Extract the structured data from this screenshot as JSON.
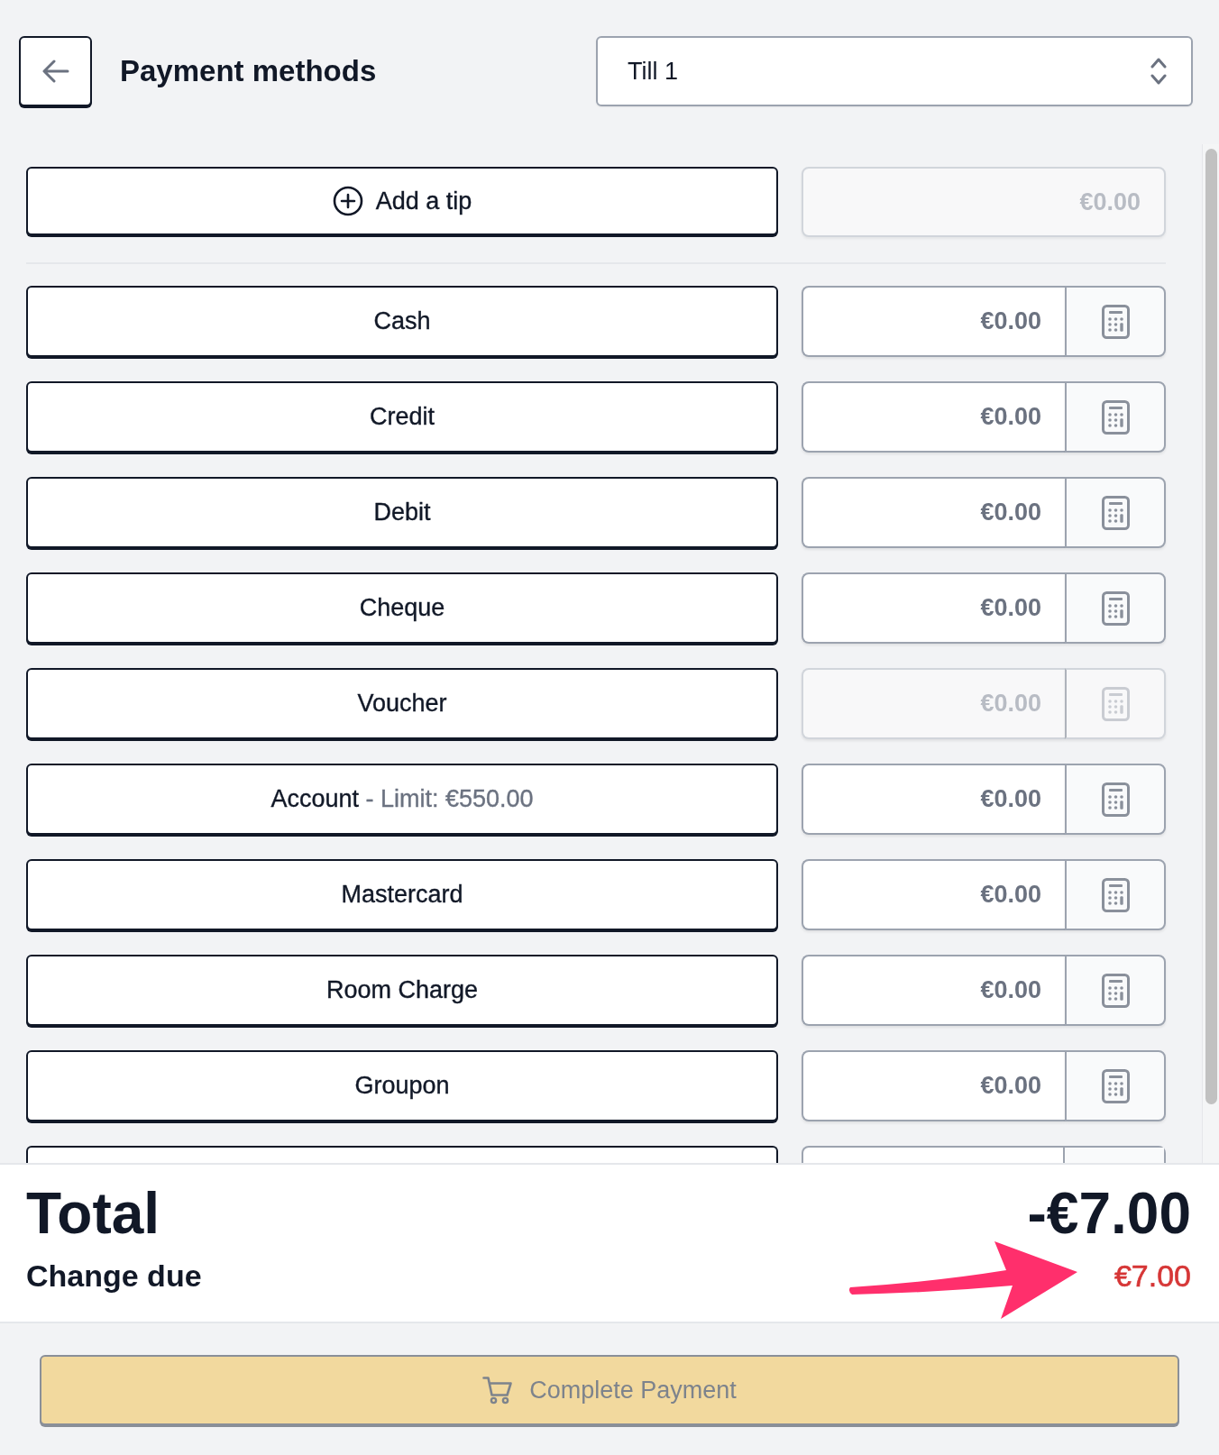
{
  "header": {
    "title": "Payment methods",
    "till_select": {
      "value": "Till 1"
    }
  },
  "tip": {
    "label": "Add a tip",
    "amount": "€0.00",
    "disabled": true
  },
  "payment_methods": [
    {
      "kind": "method",
      "label": "Cash",
      "amount": "€0.00",
      "disabled": false
    },
    {
      "kind": "method",
      "label": "Credit",
      "amount": "€0.00",
      "disabled": false
    },
    {
      "kind": "method",
      "label": "Debit",
      "amount": "€0.00",
      "disabled": false
    },
    {
      "kind": "method",
      "label": "Cheque",
      "amount": "€0.00",
      "disabled": false
    },
    {
      "kind": "method",
      "label": "Voucher",
      "amount": "€0.00",
      "disabled": true
    },
    {
      "kind": "method",
      "label": "Account",
      "note": "- Limit: €550.00",
      "amount": "€0.00",
      "disabled": false
    },
    {
      "kind": "method",
      "label": "Mastercard",
      "amount": "€0.00",
      "disabled": false
    },
    {
      "kind": "method",
      "label": "Room Charge",
      "amount": "€0.00",
      "disabled": false
    },
    {
      "kind": "method",
      "label": "Groupon",
      "amount": "€0.00",
      "disabled": false
    },
    {
      "kind": "partial"
    }
  ],
  "summary": {
    "total_label": "Total",
    "total": "-€7.00",
    "change_label": "Change due",
    "change": "€7.00"
  },
  "complete_button": {
    "label": "Complete Payment",
    "disabled": true
  }
}
